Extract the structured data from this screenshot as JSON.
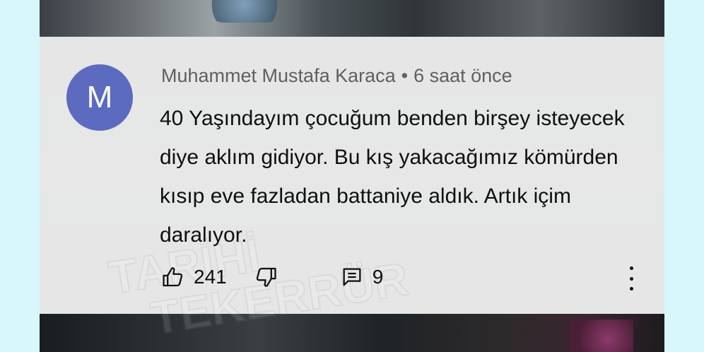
{
  "comment": {
    "avatar_letter": "M",
    "avatar_color": "#5c6bc0",
    "author": "Muhammet Mustafa Karaca",
    "separator": "•",
    "time": "6 saat önce",
    "text": "40 Yaşındayım çocuğum benden birşey isteyecek diye aklım gidiyor. Bu kış yakacağımız kömürden kısıp eve fazladan battaniye aldık. Artık içim daralıyor.",
    "likes": "241",
    "replies": "9"
  },
  "watermark": {
    "line1": "TARİHİ",
    "line2": "TEKERRÜR"
  },
  "icons": {
    "like": "thumb-up-icon",
    "dislike": "thumb-down-icon",
    "replies": "comment-icon",
    "more": "more-vert-icon"
  }
}
